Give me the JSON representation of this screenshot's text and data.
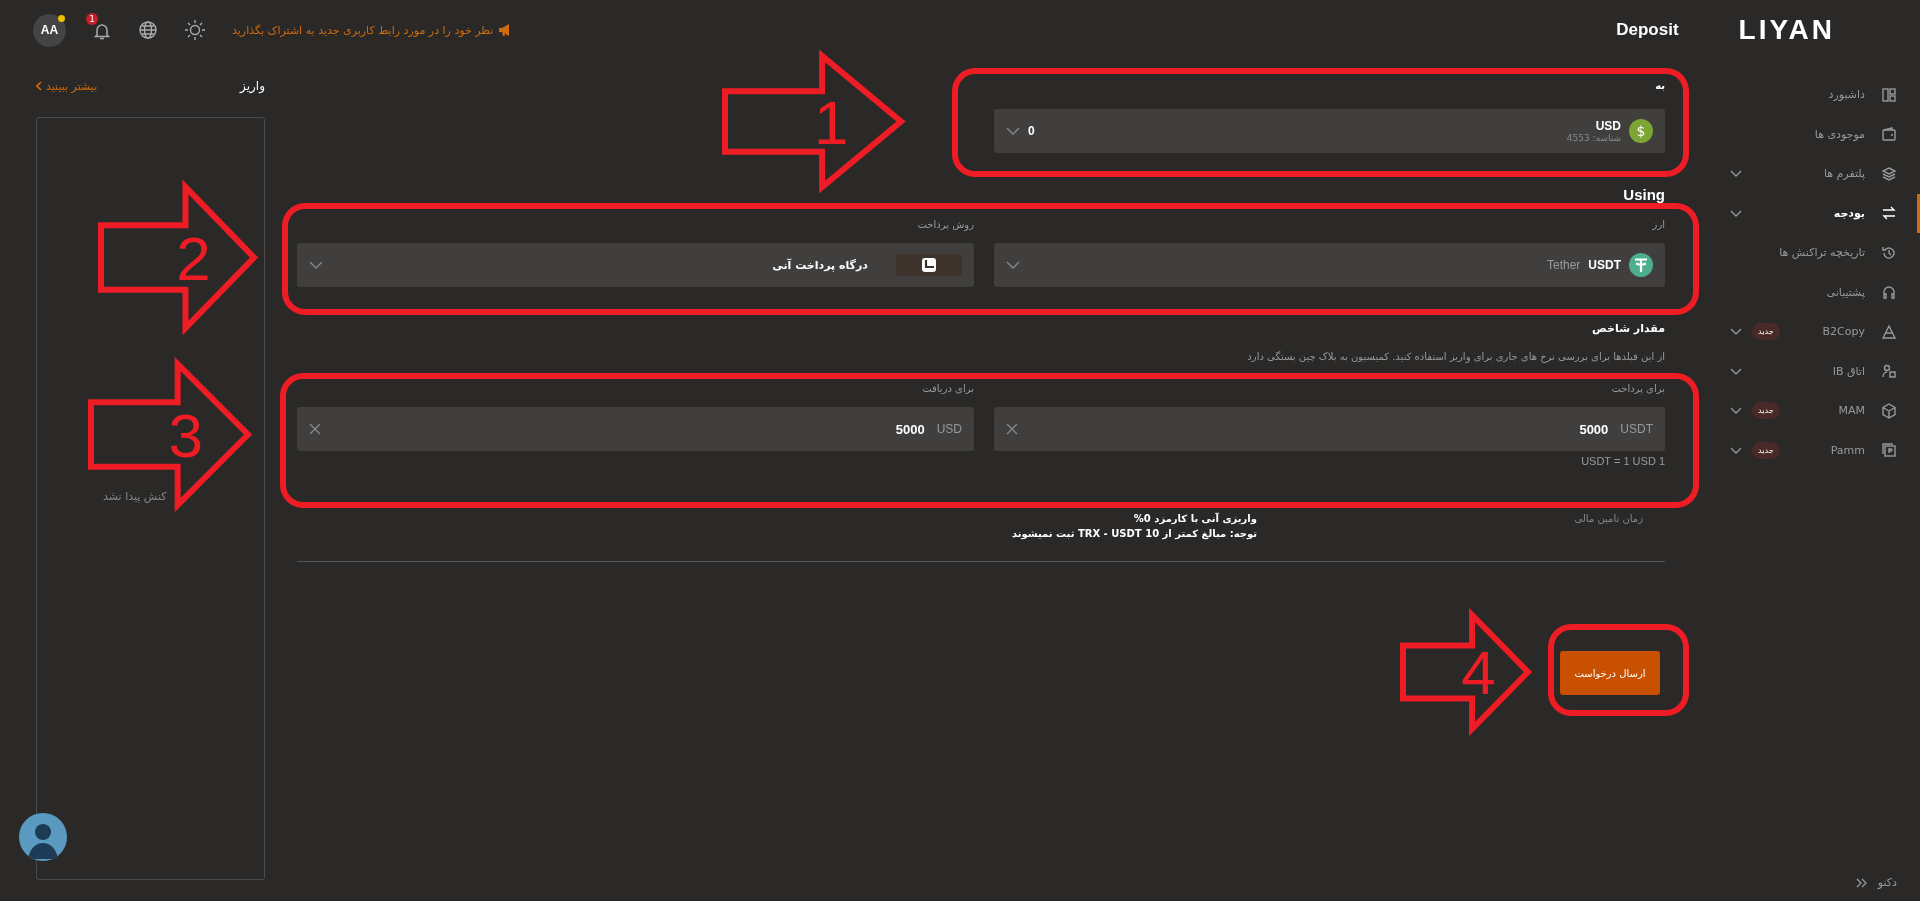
{
  "top_bar": {
    "avatar_initials": "AA",
    "notification_count": "1",
    "feedback_text": "نظر خود را در مورد رابط کاربری جدید به اشتراک بگذارید",
    "page_title": "Deposit",
    "logo_text": "LIYAN"
  },
  "sidebar": {
    "items": [
      {
        "label": "داشبورد",
        "selected": false,
        "expandable": false
      },
      {
        "label": "موجودی ها",
        "selected": false,
        "expandable": false
      },
      {
        "label": "پلتفرم ها",
        "selected": false,
        "expandable": true
      },
      {
        "label": "بودجه",
        "selected": true,
        "expandable": true
      },
      {
        "label": "تاریخچه تراکنش ها",
        "selected": false,
        "expandable": false
      },
      {
        "label": "پشتیبانی",
        "selected": false,
        "expandable": false
      },
      {
        "label": "B2Copy",
        "selected": false,
        "expandable": true,
        "badge": "جدید"
      },
      {
        "label": "اتاق IB",
        "selected": false,
        "expandable": true
      },
      {
        "label": "MAM",
        "selected": false,
        "expandable": true,
        "badge": "جدید"
      },
      {
        "label": "Pamm",
        "selected": false,
        "expandable": true,
        "badge": "جدید"
      }
    ],
    "collapse_label": "دکنو"
  },
  "deposits_panel": {
    "title": "واریز",
    "see_more": "بیشتر ببینید",
    "empty_text": "کنش پیدا نشد"
  },
  "form": {
    "to_label": "به",
    "account": {
      "symbol": "$",
      "currency": "USD",
      "account_id": "شناسه: 4553",
      "balance": "0"
    },
    "using_title": "Using",
    "currency_label": "ارز",
    "currency": {
      "code": "USDT",
      "name": "Tether"
    },
    "method_label": "روش پرداخت",
    "method": "درگاه پرداخت آنی",
    "amount_title": "مقدار شاخص",
    "amount_hint": "از این فیلدها برای بررسی نرخ های جاری برای واریز استفاده کنید. کمیسیون به بلاک چین بستگی دارد",
    "pay_label": "برای پرداخت",
    "pay": {
      "value": "5000",
      "unit": "USDT"
    },
    "receive_label": "برای دریافت",
    "receive": {
      "value": "5000",
      "unit": "USD"
    },
    "rate": "USDT = 1 USD 1",
    "funding_time_label": "زمان تامین مالی",
    "fee_note": "واریزی آنی با کارمزد 0%",
    "min_note": "توجه: مبالغ کمتر از 10 TRX - USDT ثبت نمیشوند",
    "submit": "ارسال درخواست"
  },
  "annotations": [
    {
      "label": "1"
    },
    {
      "label": "2"
    },
    {
      "label": "3"
    },
    {
      "label": "4"
    }
  ]
}
